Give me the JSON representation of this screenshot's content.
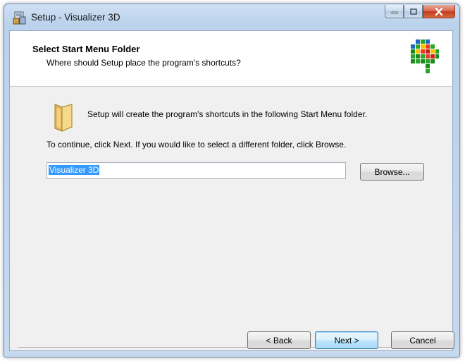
{
  "window": {
    "title": "Setup - Visualizer 3D",
    "icon": "setup-icon",
    "controls": [
      "minimize-icon",
      "maximize-icon",
      "close-icon"
    ]
  },
  "header": {
    "title": "Select Start Menu Folder",
    "subtitle": "Where should Setup place the program's shortcuts?",
    "logo": "visualizer-logo-icon"
  },
  "body": {
    "folder_icon": "folder-icon",
    "intro_text": "Setup will create the program's shortcuts in the following Start Menu folder.",
    "instruction_text": "To continue, click Next. If you would like to select a different folder, click Browse.",
    "folder_input_value": "Visualizer 3D",
    "browse_label": "Browse..."
  },
  "footer": {
    "back_label": "< Back",
    "next_label": "Next >",
    "cancel_label": "Cancel"
  },
  "colors": {
    "selection": "#3399ff",
    "default_button_border": "#3c7fb1"
  }
}
